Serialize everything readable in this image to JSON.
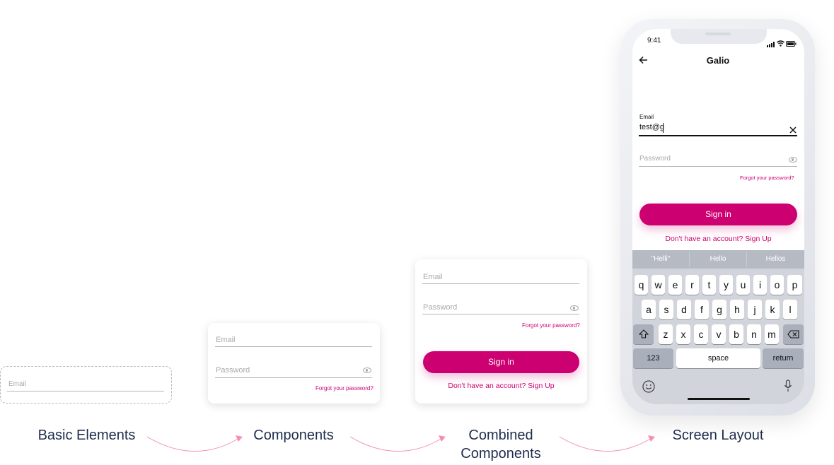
{
  "basic": {
    "email_label": "Email"
  },
  "components_card": {
    "email_label": "Email",
    "password_label": "Password",
    "forgot": "Forgot your password?"
  },
  "combined_card": {
    "email_label": "Email",
    "password_label": "Password",
    "forgot": "Forgot your password?",
    "signin": "Sign in",
    "signup": "Don't have an account? Sign Up"
  },
  "captions": {
    "basic": "Basic Elements",
    "components": "Components",
    "combined_line1": "Combined",
    "combined_line2": "Components",
    "screen": "Screen Layout"
  },
  "phone": {
    "time": "9:41",
    "title": "Galio",
    "email_label": "Email",
    "email_value": "test@g",
    "password_placeholder": "Password",
    "forgot": "Forgot your password?",
    "signin": "Sign in",
    "signup": "Don't have an account? Sign Up",
    "suggestions": [
      "\"Helli\"",
      "Hello",
      "Hellos"
    ],
    "row1": [
      "q",
      "w",
      "e",
      "r",
      "t",
      "y",
      "u",
      "i",
      "o",
      "p"
    ],
    "row2": [
      "a",
      "s",
      "d",
      "f",
      "g",
      "h",
      "j",
      "k",
      "l"
    ],
    "row3": [
      "z",
      "x",
      "c",
      "v",
      "b",
      "n",
      "m"
    ],
    "key_123": "123",
    "key_space": "space",
    "key_return": "return"
  },
  "colors": {
    "accent": "#cc0070",
    "caption": "#1f2d4d",
    "arrow": "#f48fb1"
  }
}
